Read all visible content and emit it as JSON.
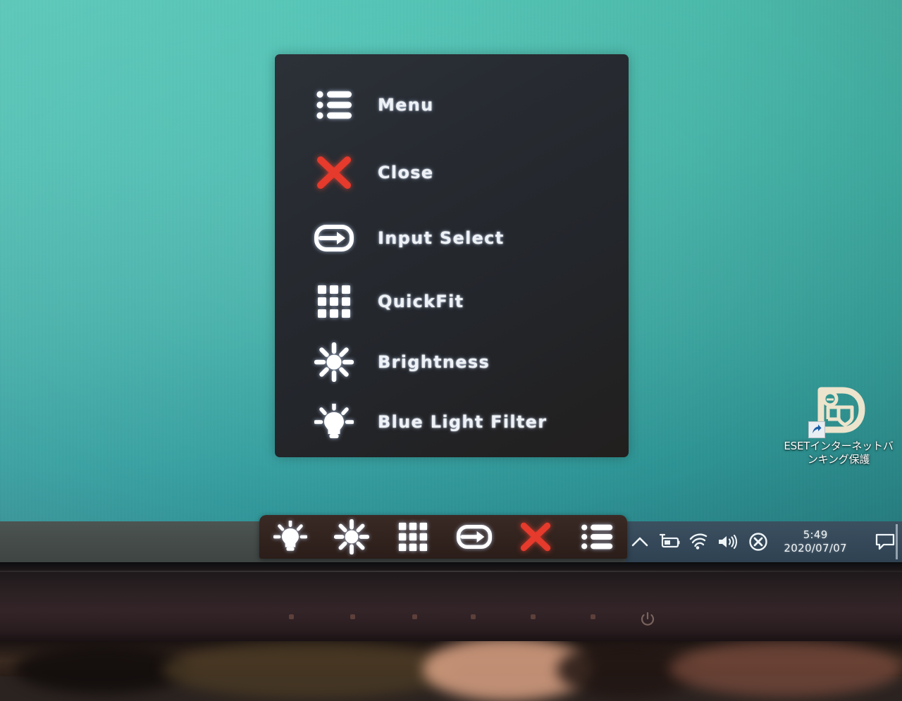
{
  "desktop": {
    "background_color": "#3aafa8",
    "icon": {
      "name": "eset-internet-banking-protection",
      "label_line1": "ESETインターネットバ",
      "label_line2": "ンキング保護"
    }
  },
  "osd": {
    "panel_color": "#26292e",
    "items": [
      {
        "icon": "list-menu-icon",
        "label": "Menu",
        "color": "#ffffff"
      },
      {
        "icon": "close-x-icon",
        "label": "Close",
        "color": "#e53a2c"
      },
      {
        "icon": "input-select-icon",
        "label": "Input Select",
        "color": "#ffffff"
      },
      {
        "icon": "quickfit-grid-icon",
        "label": "QuickFit",
        "color": "#ffffff"
      },
      {
        "icon": "brightness-sun-icon",
        "label": "Brightness",
        "color": "#ffffff"
      },
      {
        "icon": "blue-light-bulb-icon",
        "label": "Blue Light Filter",
        "color": "#ffffff"
      }
    ],
    "toolbar": {
      "background_color": "#33241f",
      "buttons": [
        {
          "icon": "blue-light-bulb-icon",
          "name": "Blue Light Filter",
          "color": "#ffffff"
        },
        {
          "icon": "brightness-sun-icon",
          "name": "Brightness",
          "color": "#ffffff"
        },
        {
          "icon": "quickfit-grid-icon",
          "name": "QuickFit",
          "color": "#ffffff"
        },
        {
          "icon": "input-select-icon",
          "name": "Input Select",
          "color": "#ffffff"
        },
        {
          "icon": "close-x-icon",
          "name": "Close",
          "color": "#e53a2c"
        },
        {
          "icon": "list-menu-icon",
          "name": "Menu",
          "color": "#ffffff"
        }
      ]
    }
  },
  "taskbar": {
    "background_color": "#465350",
    "tray_background_color": "#36495a",
    "tray": [
      {
        "icon": "chevron-up-icon",
        "name": "Show hidden icons"
      },
      {
        "icon": "battery-charging-icon",
        "name": "Power / battery"
      },
      {
        "icon": "wifi-icon",
        "name": "Network"
      },
      {
        "icon": "volume-icon",
        "name": "Volume"
      },
      {
        "icon": "x-circle-icon",
        "name": "ESET status"
      }
    ],
    "clock": {
      "time": "5:49",
      "date": "2020/07/07"
    },
    "action_center": {
      "icon": "speech-bubble-icon",
      "name": "Action Center"
    }
  },
  "monitor": {
    "bezel_color": "#2a2022",
    "power_icon": "power-icon"
  }
}
